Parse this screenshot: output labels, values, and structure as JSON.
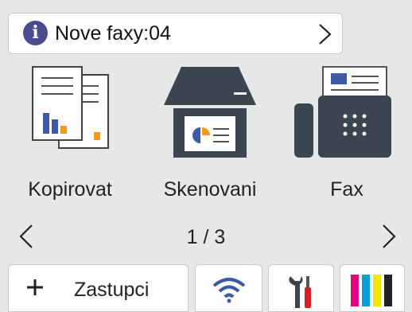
{
  "notification": {
    "text": "Nove faxy:04",
    "info_icon": "info-icon",
    "chevron_icon": "chevron-right-icon"
  },
  "apps": [
    {
      "label": "Kopirovat",
      "icon": "copy-icon"
    },
    {
      "label": "Skenovani",
      "icon": "scanner-icon"
    },
    {
      "label": "Fax",
      "icon": "fax-icon"
    }
  ],
  "pager": {
    "text": "1 / 3",
    "prev_icon": "chevron-left-icon",
    "next_icon": "chevron-right-icon"
  },
  "bottom_bar": {
    "shortcut_label": "Zastupci",
    "shortcut_icon": "plus-icon",
    "wifi_icon": "wifi-icon",
    "settings_icon": "tools-icon",
    "toner_icon": "toner-icon"
  },
  "colors": {
    "background": "#e6e7e7",
    "tile": "#ffffff",
    "dark_device": "#3b4550",
    "accent_blue": "#3d5aa6",
    "accent_orange": "#f39a1a",
    "info_purple": "#4a4a8f",
    "toner_cyan": "#00a0d8",
    "toner_magenta": "#e5007e",
    "toner_yellow": "#f3e600",
    "toner_black": "#222222",
    "settings_red": "#d32027"
  }
}
